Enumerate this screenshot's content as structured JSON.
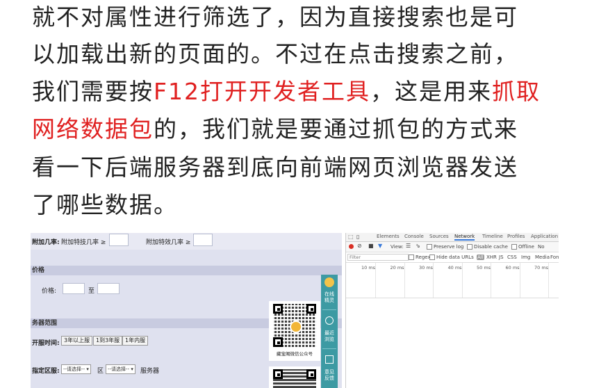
{
  "article": {
    "lines": [
      {
        "segments": [
          {
            "text": "就不对属性进行筛选了，因为直接搜索也是可",
            "red": false
          }
        ]
      },
      {
        "segments": [
          {
            "text": "以加载出新的页面的。不过在点击搜索之前，",
            "red": false
          }
        ]
      },
      {
        "segments": [
          {
            "text": "我们需要按",
            "red": false
          },
          {
            "text": "F12打开开发者工具",
            "red": true
          },
          {
            "text": "，这是用来",
            "red": false
          },
          {
            "text": "抓取",
            "red": true
          }
        ]
      },
      {
        "segments": [
          {
            "text": "网络数据包",
            "red": true
          },
          {
            "text": "的，我们就是要通过抓包的方式来",
            "red": false
          }
        ]
      },
      {
        "segments": [
          {
            "text": "看一下后端服务器到底向前端网页浏览器发送",
            "red": false
          }
        ]
      },
      {
        "segments": [
          {
            "text": "了哪些数据。",
            "red": false
          }
        ]
      }
    ]
  },
  "screenshot": {
    "page": {
      "row1_label1": "附加几率:",
      "row1_field1": "附加特技几率 ≥",
      "row1_field2": "附加特效几率 ≥",
      "price_header": "价格",
      "price_label": "价格:",
      "price_to": "至",
      "server_header": "务器范围",
      "open_time_label": "开服时间:",
      "open_time_buttons": [
        "3年以上服",
        "1到3年服",
        "1年内服"
      ],
      "region_label": "指定区服:",
      "region_select1": "--请选择-- ▾",
      "region_mid": "区",
      "region_select2": "--请选择-- ▾",
      "region_suffix": "服务器",
      "qr_caption": "藏宝阁微信公众号",
      "side_items": [
        "在线\n精灵",
        "最近\n浏览",
        "意见\n反馈"
      ]
    },
    "devtools": {
      "tabs": [
        "Elements",
        "Console",
        "Sources",
        "Network",
        "Timeline",
        "Profiles",
        "Application"
      ],
      "active_tab": "Network",
      "toolbar": {
        "view": "View:",
        "preserve_log": "Preserve log",
        "disable_cache": "Disable cache",
        "offline": "Offline",
        "no_throttle": "No"
      },
      "filter": {
        "placeholder": "Filter",
        "regex": "Regex",
        "hide_data_urls": "Hide data URLs",
        "types": [
          "All",
          "XHR",
          "JS",
          "CSS",
          "Img",
          "Media",
          "Font"
        ]
      },
      "timeline_ticks": [
        "10 ms",
        "20 ms",
        "30 ms",
        "40 ms",
        "50 ms",
        "60 ms",
        "70 ms"
      ]
    }
  }
}
